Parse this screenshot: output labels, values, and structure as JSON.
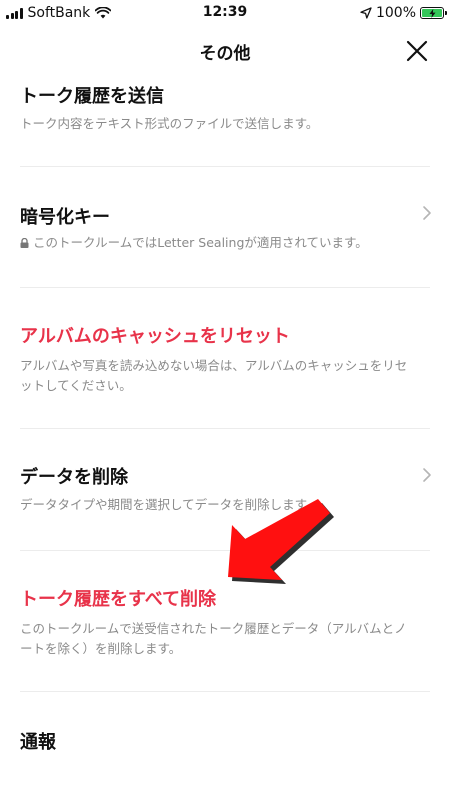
{
  "status_bar": {
    "carrier": "SoftBank",
    "time": "12:39",
    "battery": "100%",
    "icons": [
      "signal-icon",
      "wifi-icon",
      "location-icon",
      "battery-icon"
    ]
  },
  "header": {
    "title": "その他",
    "close_icon": "close-icon"
  },
  "items": [
    {
      "title": "トーク履歴を送信",
      "description": "トーク内容をテキスト形式のファイルで送信します。"
    },
    {
      "title": "暗号化キー",
      "description": "このトークルームではLetter Sealingが適用されています。",
      "icon": "lock-icon",
      "has_chevron": true
    },
    {
      "title": "アルバムのキャッシュをリセット",
      "description": "アルバムや写真を読み込めない場合は、アルバムのキャッシュをリセットしてください。",
      "color": "#e8334a"
    },
    {
      "title": "データを削除",
      "description": "データタイプや期間を選択してデータを削除します。",
      "has_chevron": true
    },
    {
      "title": "トーク履歴をすべて削除",
      "description": "このトークルームで送受信されたトーク履歴とデータ（アルバムとノートを除く）を削除します。",
      "color": "#e8334a"
    },
    {
      "title": "通報"
    }
  ],
  "colors": {
    "accent_red": "#e8334a",
    "description_gray": "#8a8a8a",
    "battery_green": "#34c759",
    "annotation_arrow": "#ff1010"
  }
}
